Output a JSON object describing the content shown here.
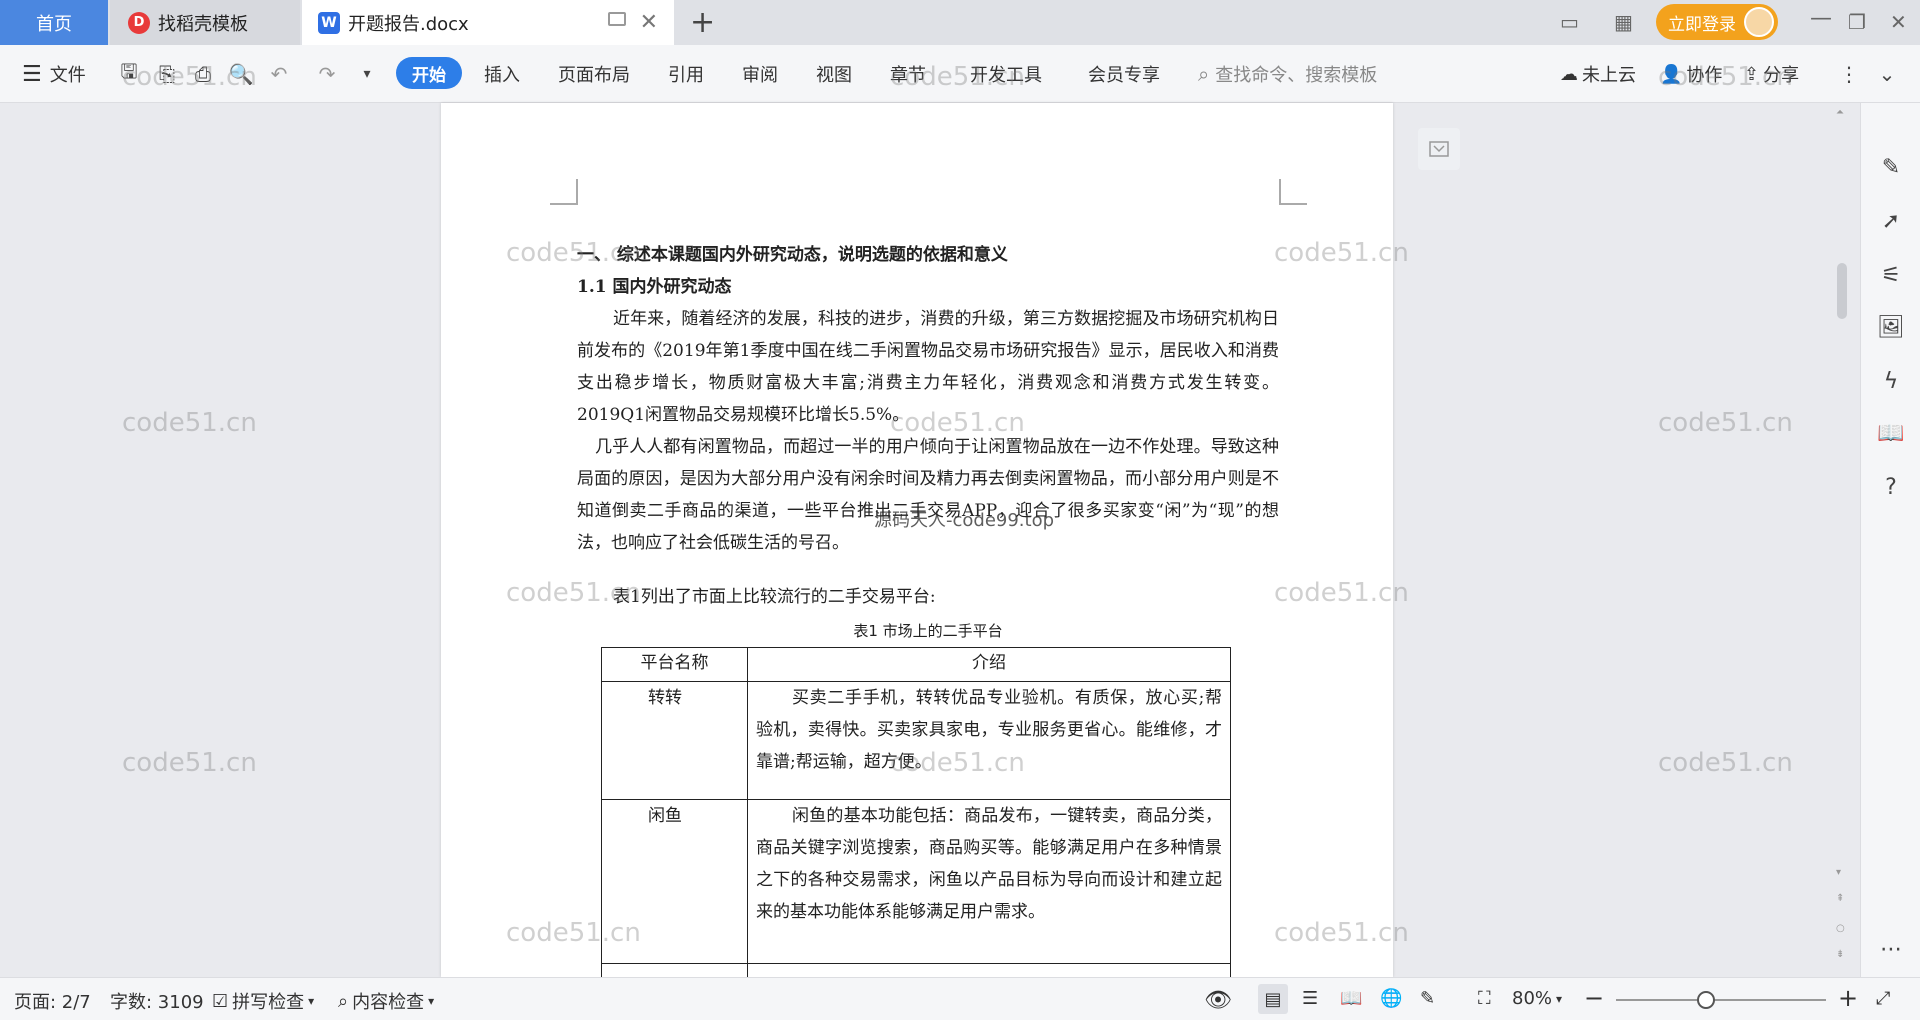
{
  "tabs": {
    "home": "首页",
    "templates": "找稻壳模板",
    "document": "开题报告.docx"
  },
  "titlebar": {
    "login_label": "立即登录"
  },
  "ribbon": {
    "file_label": "文件",
    "menu": [
      "开始",
      "插入",
      "页面布局",
      "引用",
      "审阅",
      "视图",
      "章节",
      "开发工具",
      "会员专享"
    ],
    "search_placeholder": "查找命令、搜索模板",
    "cloud_label": "未上云",
    "collab_label": "协作",
    "share_label": "分享"
  },
  "document": {
    "heading1": "一、 综述本课题国内外研究动态，说明选题的依据和意义",
    "heading2": "1.1 国内外研究动态",
    "para1": "近年来，随着经济的发展，科技的进步，消费的升级，第三方数据挖掘及市场研究机构日前发布的《2019年第1季度中国在线二手闲置物品交易市场研究报告》显示，居民收入和消费支出稳步增长，物质财富极大丰富;消费主力年轻化，消费观念和消费方式发生转变。2019Q1闲置物品交易规模环比增长5.5%。",
    "para2": "几乎人人都有闲置物品，而超过一半的用户倾向于让闲置物品放在一边不作处理。导致这种局面的原因，是因为大部分用户没有闲余时间及精力再去倒卖闲置物品，而小部分用户则是不知道倒卖二手商品的渠道，一些平台推出二手交易APP，迎合了很多买家变“闲”为“现”的想法，也响应了社会低碳生活的号召。",
    "para3": "表1列出了市面上比较流行的二手交易平台:",
    "table_caption": "表1 市场上的二手平台",
    "table_headers": [
      "平台名称",
      "介绍"
    ],
    "table_rows": [
      {
        "name": "转转",
        "intro": "买卖二手手机，转转优品专业验机。有质保，放心买;帮验机，卖得快。买卖家具家电，专业服务更省心。能维修，才靠谱;帮运输，超方便。"
      },
      {
        "name": "闲鱼",
        "intro": "闲鱼的基本功能包括：商品发布，一键转卖，商品分类，商品关键字浏览搜索，商品购买等。能够满足用户在多种情景之下的各种交易需求，闲鱼以产品目标为导向而设计和建立起来的基本功能体系能够满足用户需求。"
      }
    ]
  },
  "watermarks": {
    "site": "code51.cn",
    "center": "源码天人-code99.top"
  },
  "statusbar": {
    "page": "页面: 2/7",
    "words": "字数: 3109",
    "spell": "拼写检查",
    "content_check": "内容检查",
    "zoom": "80%"
  },
  "zoom_level": 0.8
}
